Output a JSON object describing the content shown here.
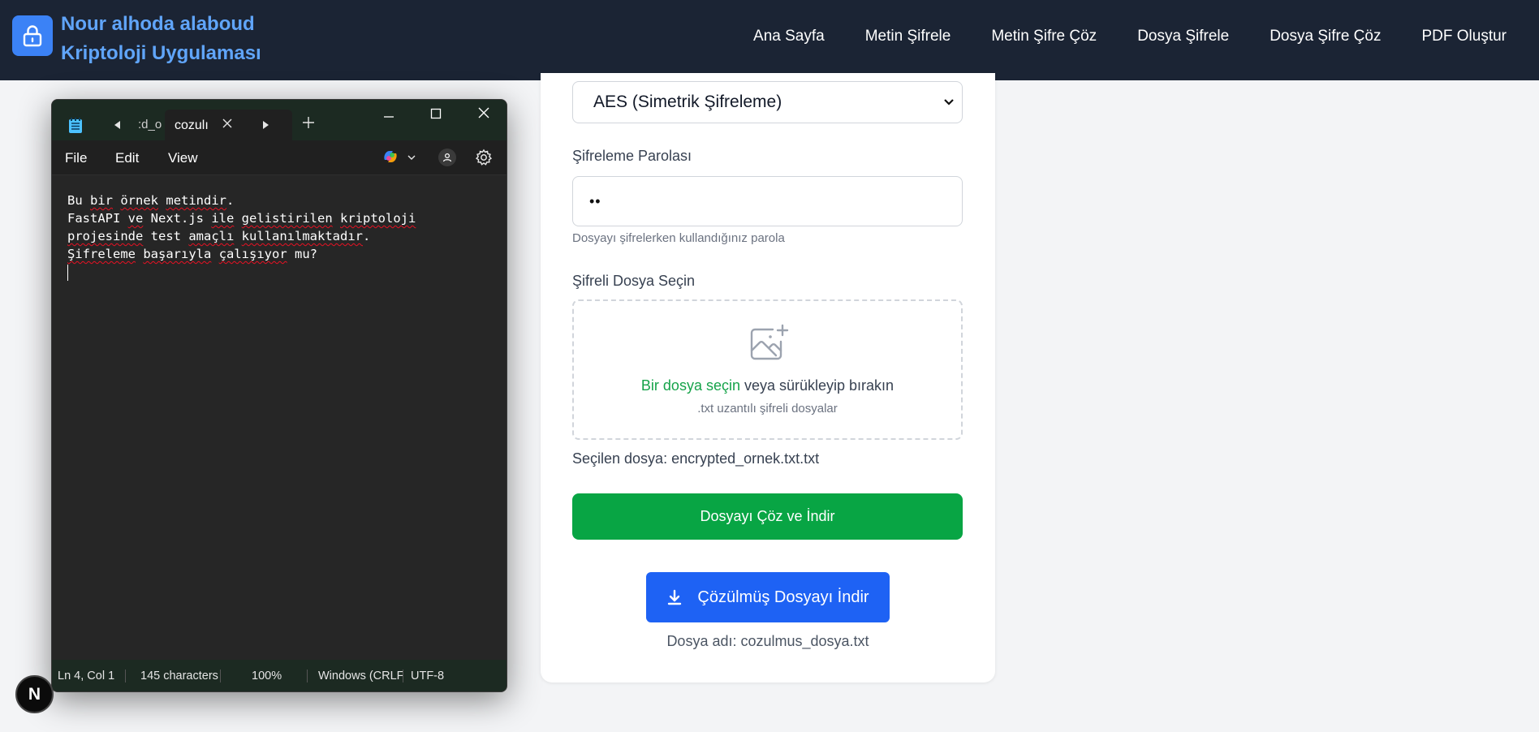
{
  "header": {
    "brand_line1": "Nour alhoda alaboud",
    "brand_line2": "Kriptoloji Uygulaması",
    "nav": [
      "Ana Sayfa",
      "Metin Şifrele",
      "Metin Şifre Çöz",
      "Dosya Şifrele",
      "Dosya Şifre Çöz",
      "PDF Oluştur"
    ]
  },
  "form": {
    "algorithm_selected": "AES (Simetrik Şifreleme)",
    "password_label": "Şifreleme Parolası",
    "password_value": "••",
    "password_hint": "Dosyayı şifrelerken kullandığınız parola",
    "file_label": "Şifreli Dosya Seçin",
    "dropzone_link": "Bir dosya seçin",
    "dropzone_text": " veya sürükleyip bırakın",
    "dropzone_sub": ".txt uzantılı şifreli dosyalar",
    "selected_file": "Seçilen dosya: encrypted_ornek.txt.txt",
    "decrypt_button": "Dosyayı Çöz ve İndir",
    "download_button": "Çözülmüş Dosyayı İndir",
    "download_filename": "Dosya adı: cozulmus_dosya.txt"
  },
  "notepad": {
    "tab_inactive": ":d_o",
    "tab_active": "cozulı",
    "menu": [
      "File",
      "Edit",
      "View"
    ],
    "lines": [
      "Bu bir örnek metindir.",
      "FastAPI ve Next.js ile gelistirilen kriptoloji",
      "projesinde test amaçlı kullanılmaktadır.",
      "Şifreleme başarıyla çalışıyor mu?"
    ],
    "status": {
      "position": "Ln 4, Col 1",
      "chars": "145 characters",
      "zoom": "100%",
      "eol": "Windows (CRLF",
      "encoding": "UTF-8"
    }
  },
  "badge": "N",
  "colors": {
    "header_bg": "#1b2434",
    "brand": "#60a5fa",
    "green_button": "#08a544",
    "blue_button": "#1e62f4",
    "notepad_bg": "#202020"
  }
}
